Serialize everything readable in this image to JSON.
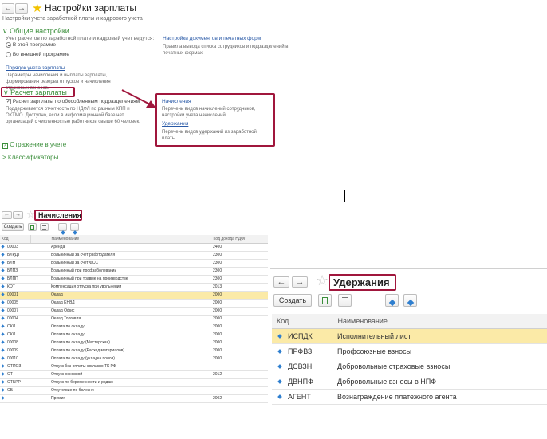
{
  "settings": {
    "back": "←",
    "fwd": "→",
    "title": "Настройки зарплаты",
    "subtitle": "Настройки учета заработной платы и кадрового учета",
    "general": {
      "header": "Общие настройки",
      "question": "Учет расчетов по заработной плате и кадровый учет ведутся:",
      "opt1": "В этой программе",
      "opt2": "Во внешней программе",
      "order_link": "Порядок учета зарплаты",
      "order_desc": "Параметры начисления и выплаты зарплаты, формирования резерва отпусков и начисления страховых взносов.",
      "docs_link": "Настройки документов и печатных форм",
      "docs_desc": "Правила вывода списка сотрудников и подразделений в печатных формах."
    },
    "calc": {
      "header": "Расчет зарплаты",
      "checkbox": "Расчет зарплаты по обособленным подразделениям",
      "desc": "Поддерживается отчетность по НДФЛ по разным КПП и ОКТМО. Доступно, если в информационной базе нет организаций с численностью работников свыше 60 человек.",
      "accruals_link": "Начисления",
      "accruals_desc": "Перечень видов начислений сотрудников, настройки учета начислений.",
      "deductions_link": "Удержания",
      "deductions_desc": "Перечень видов удержаний из заработной платы."
    },
    "reflect": "Отражение в учете",
    "classifiers": "Классификаторы"
  },
  "accruals": {
    "title": "Начисления",
    "create": "Создать",
    "col_code": "Код",
    "col_name": "Наименование",
    "col_ndfl": "Код дохода НДФЛ",
    "rows": [
      {
        "code": "00003",
        "name": "Аренда",
        "ndfl": "2400"
      },
      {
        "code": "БЛРДТ",
        "name": "Больничный за счет работодателя",
        "ndfl": "2300"
      },
      {
        "code": "БЛН",
        "name": "Больничный за счет ФСС",
        "ndfl": "2300"
      },
      {
        "code": "БЛПЗ",
        "name": "Больничный при профзаболевании",
        "ndfl": "2300"
      },
      {
        "code": "БЛПП",
        "name": "Больничный при травме на производстве",
        "ndfl": "2300"
      },
      {
        "code": "КОТ",
        "name": "Компенсация отпуска при увольнении",
        "ndfl": "2013"
      },
      {
        "code": "00001",
        "name": "Оклад",
        "ndfl": "2000"
      },
      {
        "code": "00005",
        "name": "Оклад ЕНВД",
        "ndfl": "2000"
      },
      {
        "code": "00007",
        "name": "Оклад Офис",
        "ndfl": "2000"
      },
      {
        "code": "00004",
        "name": "Оклад Торговля",
        "ndfl": "2000"
      },
      {
        "code": "ОКЛ",
        "name": "Оплата по окладу",
        "ndfl": "2000"
      },
      {
        "code": "ОКЛ",
        "name": "Оплата по окладу",
        "ndfl": "2000"
      },
      {
        "code": "00008",
        "name": "Оплата по окладу (Мастерская)",
        "ndfl": "2000"
      },
      {
        "code": "00009",
        "name": "Оплата по окладу (Расход материалов)",
        "ndfl": "2000"
      },
      {
        "code": "00010",
        "name": "Оплата по окладу (укладка полов)",
        "ndfl": "2000"
      },
      {
        "code": "ОТПОЗ",
        "name": "Отпуск без оплаты согласно ТК РФ",
        "ndfl": ""
      },
      {
        "code": "ОТ",
        "name": "Отпуск основной",
        "ndfl": "2012"
      },
      {
        "code": "ОТБРР",
        "name": "Отпуск по беременности и родам",
        "ndfl": ""
      },
      {
        "code": "ОБ",
        "name": "Отсутствие по болезни",
        "ndfl": ""
      },
      {
        "code": "",
        "name": "Премия",
        "ndfl": "2002"
      }
    ]
  },
  "deductions": {
    "title": "Удержания",
    "create": "Создать",
    "col_code": "Код",
    "col_name": "Наименование",
    "rows": [
      {
        "code": "ИСПДК",
        "name": "Исполнительный лист"
      },
      {
        "code": "ПРФВЗ",
        "name": "Профсоюзные взносы"
      },
      {
        "code": "ДСВЗН",
        "name": "Добровольные страховые взносы"
      },
      {
        "code": "ДВНПФ",
        "name": "Добровольные взносы в НПФ"
      },
      {
        "code": "АГЕНТ",
        "name": "Вознаграждение платежного агента"
      }
    ]
  },
  "colors": {
    "frame": "#a0163c",
    "accent_green": "#3a8e3a",
    "highlight": "#fbeaa7",
    "star": "#f2c200"
  }
}
